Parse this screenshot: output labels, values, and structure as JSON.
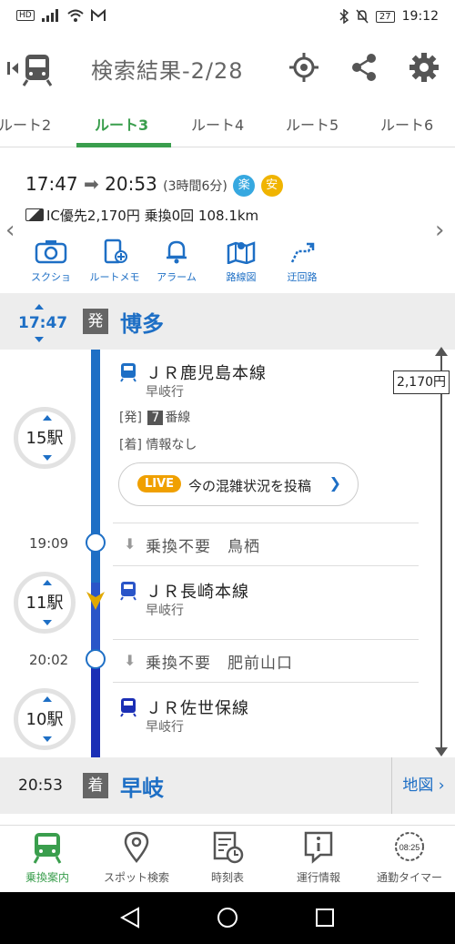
{
  "status_bar": {
    "hd": "HD",
    "battery": "27",
    "time": "19:12"
  },
  "app_bar": {
    "title": "検索結果-2/28"
  },
  "tabs": [
    {
      "label": "ルート2"
    },
    {
      "label": "ルート3"
    },
    {
      "label": "ルート4"
    },
    {
      "label": "ルート5"
    },
    {
      "label": "ルート6"
    }
  ],
  "summary": {
    "depart": "17:47",
    "arrow": "➡",
    "arrive": "20:53",
    "duration": "(3時間6分)",
    "badge_easy": "楽",
    "badge_safe": "安",
    "fare_line": "IC優先2,170円 乗換0回 108.1km"
  },
  "tools": [
    {
      "label": "スクショ",
      "icon": "camera-icon"
    },
    {
      "label": "ルートメモ",
      "icon": "route-memo-icon"
    },
    {
      "label": "アラーム",
      "icon": "bell-icon"
    },
    {
      "label": "路線図",
      "icon": "map-icon"
    },
    {
      "label": "迂回路",
      "icon": "detour-icon"
    }
  ],
  "route": {
    "origin": {
      "time": "17:47",
      "tag": "発",
      "name": "博多"
    },
    "segments": [
      {
        "stations": "15駅",
        "line": "ＪＲ鹿児島本線",
        "dest": "早岐行",
        "info_depart_prefix": "[発]",
        "track": "7",
        "track_suffix": "番線",
        "info_arrive": "[着] 情報なし"
      },
      {
        "stations": "11駅",
        "line": "ＪＲ長崎本線",
        "dest": "早岐行"
      },
      {
        "stations": "10駅",
        "line": "ＪＲ佐世保線",
        "dest": "早岐行"
      }
    ],
    "transfers": [
      {
        "time": "19:09",
        "text": "乗換不要　鳥栖"
      },
      {
        "time": "20:02",
        "text": "乗換不要　肥前山口"
      }
    ],
    "destination": {
      "time": "20:53",
      "tag": "着",
      "name": "早岐"
    },
    "live": {
      "badge": "LIVE",
      "text": "今の混雑状況を投稿"
    },
    "fare_total": "2,170円",
    "map_button": "地図"
  },
  "bottom_nav": [
    {
      "label": "乗換案内",
      "icon": "train-icon",
      "active": true
    },
    {
      "label": "スポット検索",
      "icon": "location-pin-icon"
    },
    {
      "label": "時刻表",
      "icon": "timetable-icon"
    },
    {
      "label": "運行情報",
      "icon": "info-icon"
    },
    {
      "label": "通勤タイマー",
      "icon": "timer-icon",
      "timer_text": "08:25"
    }
  ],
  "colors": {
    "accent_green": "#3a9e4d",
    "route_blue": "#1e6fc5",
    "route_dark_blue": "#1b2fb5",
    "live_orange": "#f0a000",
    "badge_easy": "#36a8e0",
    "badge_safe": "#f0b400"
  }
}
